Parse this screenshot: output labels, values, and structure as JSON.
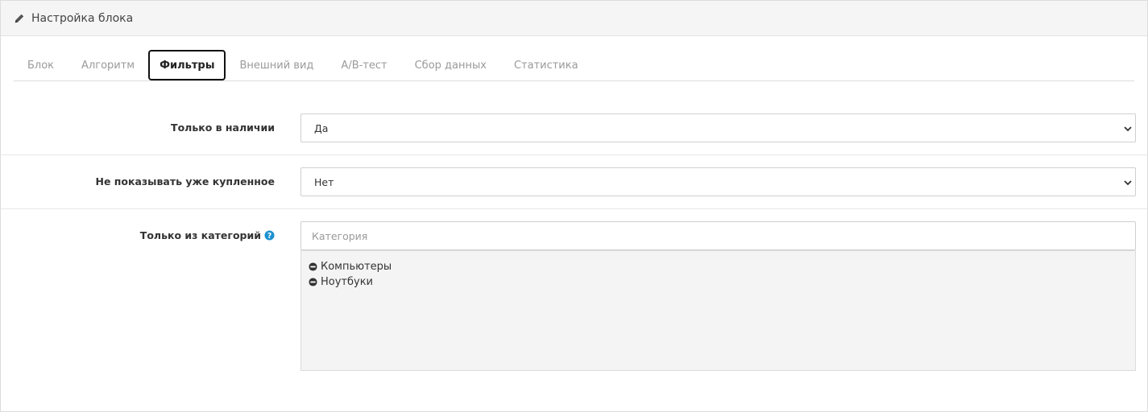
{
  "header": {
    "title": "Настройка блока",
    "icon": "pencil-icon"
  },
  "tabs": [
    {
      "label": "Блок",
      "active": false
    },
    {
      "label": "Алгоритм",
      "active": false
    },
    {
      "label": "Фильтры",
      "active": true
    },
    {
      "label": "Внешний вид",
      "active": false
    },
    {
      "label": "A/B-тест",
      "active": false
    },
    {
      "label": "Сбор данных",
      "active": false
    },
    {
      "label": "Статистика",
      "active": false
    }
  ],
  "fields": {
    "in_stock": {
      "label": "Только в наличии",
      "value": "Да"
    },
    "hide_purchased": {
      "label": "Не показывать уже купленное",
      "value": "Нет"
    },
    "categories": {
      "label": "Только из категорий",
      "placeholder": "Категория",
      "help_icon": "question-circle-icon",
      "items": [
        "Компьютеры",
        "Ноутбуки"
      ],
      "item_icon": "minus-circle-icon"
    }
  },
  "colors": {
    "help_icon": "#1e91cf",
    "active_tab_border": "#111111"
  }
}
